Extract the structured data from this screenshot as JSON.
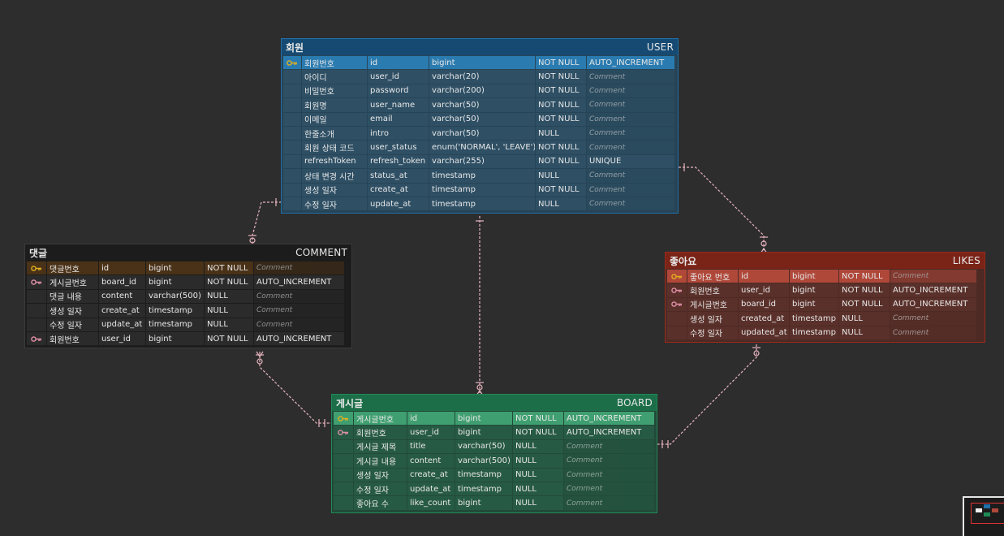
{
  "tables": [
    {
      "id": "user",
      "name": "회원",
      "english": "USER",
      "header_color": "#164a72",
      "body_color": "#274456",
      "cell_color": "#2e4f64",
      "pk_color": "#2a7bb0",
      "border_color": "#1f6fa8",
      "key_box_color": "#2e4f64",
      "columns": [
        {
          "key": "pk",
          "label": "회원번호",
          "name": "id",
          "type": "bigint",
          "null": "NOT NULL",
          "extra": "AUTO_INCREMENT",
          "is_comment": false
        },
        {
          "key": "",
          "label": "아이디",
          "name": "user_id",
          "type": "varchar(20)",
          "null": "NOT NULL",
          "extra": "Comment",
          "is_comment": true
        },
        {
          "key": "",
          "label": "비밀번호",
          "name": "password",
          "type": "varchar(200)",
          "null": "NOT NULL",
          "extra": "Comment",
          "is_comment": true
        },
        {
          "key": "",
          "label": "회원명",
          "name": "user_name",
          "type": "varchar(50)",
          "null": "NOT NULL",
          "extra": "Comment",
          "is_comment": true
        },
        {
          "key": "",
          "label": "이메일",
          "name": "email",
          "type": "varchar(50)",
          "null": "NOT NULL",
          "extra": "Comment",
          "is_comment": true
        },
        {
          "key": "",
          "label": "한줄소개",
          "name": "intro",
          "type": "varchar(50)",
          "null": "NULL",
          "extra": "Comment",
          "is_comment": true
        },
        {
          "key": "",
          "label": "회원 상태 코드",
          "name": "user_status",
          "type": "enum('NORMAL', 'LEAVE')",
          "null": "NOT NULL",
          "extra": "Comment",
          "is_comment": true
        },
        {
          "key": "",
          "label": "refreshToken",
          "name": "refresh_token",
          "type": "varchar(255)",
          "null": "NOT NULL",
          "extra": "UNIQUE",
          "is_comment": false
        },
        {
          "key": "",
          "label": "상태 변경 시간",
          "name": "status_at",
          "type": "timestamp",
          "null": "NULL",
          "extra": "Comment",
          "is_comment": true
        },
        {
          "key": "",
          "label": "생성 일자",
          "name": "create_at",
          "type": "timestamp",
          "null": "NOT NULL",
          "extra": "Comment",
          "is_comment": true
        },
        {
          "key": "",
          "label": "수정 일자",
          "name": "update_at",
          "type": "timestamp",
          "null": "NULL",
          "extra": "Comment",
          "is_comment": true
        }
      ]
    },
    {
      "id": "comment",
      "name": "댓글",
      "english": "COMMENT",
      "header_color": "#1c1c1c",
      "body_color": "#1c1c1c",
      "cell_color": "#2b2b2b",
      "pk_color": "#4a3218",
      "border_color": "#3a3a3a",
      "key_box_color": "#2b2b2b",
      "columns": [
        {
          "key": "pk",
          "label": "댓글번호",
          "name": "id",
          "type": "bigint",
          "null": "NOT NULL",
          "extra": "Comment",
          "is_comment": true
        },
        {
          "key": "fk",
          "label": "게시글번호",
          "name": "board_id",
          "type": "bigint",
          "null": "NOT NULL",
          "extra": "AUTO_INCREMENT",
          "is_comment": false
        },
        {
          "key": "",
          "label": "댓글 내용",
          "name": "content",
          "type": "varchar(500)",
          "null": "NULL",
          "extra": "Comment",
          "is_comment": true
        },
        {
          "key": "",
          "label": "생성 일자",
          "name": "create_at",
          "type": "timestamp",
          "null": "NULL",
          "extra": "Comment",
          "is_comment": true
        },
        {
          "key": "",
          "label": "수정 일자",
          "name": "update_at",
          "type": "timestamp",
          "null": "NULL",
          "extra": "Comment",
          "is_comment": true
        },
        {
          "key": "fk",
          "label": "회원번호",
          "name": "user_id",
          "type": "bigint",
          "null": "NOT NULL",
          "extra": "AUTO_INCREMENT",
          "is_comment": false
        }
      ]
    },
    {
      "id": "likes",
      "name": "좋아요",
      "english": "LIKES",
      "header_color": "#7a2418",
      "body_color": "#4e2a25",
      "cell_color": "#5a302a",
      "pk_color": "#b0483a",
      "border_color": "#9a2a1c",
      "key_box_color": "#5a302a",
      "columns": [
        {
          "key": "pk",
          "label": "좋아요 번호",
          "name": "id",
          "type": "bigint",
          "null": "NOT NULL",
          "extra": "Comment",
          "is_comment": true
        },
        {
          "key": "fk",
          "label": "회원번호",
          "name": "user_id",
          "type": "bigint",
          "null": "NOT NULL",
          "extra": "AUTO_INCREMENT",
          "is_comment": false
        },
        {
          "key": "fk",
          "label": "게시글번호",
          "name": "board_id",
          "type": "bigint",
          "null": "NOT NULL",
          "extra": "AUTO_INCREMENT",
          "is_comment": false
        },
        {
          "key": "",
          "label": "생성 일자",
          "name": "created_at",
          "type": "timestamp",
          "null": "NULL",
          "extra": "Comment",
          "is_comment": true
        },
        {
          "key": "",
          "label": "수정 일자",
          "name": "updated_at",
          "type": "timestamp",
          "null": "NULL",
          "extra": "Comment",
          "is_comment": true
        }
      ]
    },
    {
      "id": "board",
      "name": "게시글",
      "english": "BOARD",
      "header_color": "#1c6e48",
      "body_color": "#214a3a",
      "cell_color": "#275a44",
      "pk_color": "#3f9f70",
      "border_color": "#1f8a56",
      "key_box_color": "#275a44",
      "columns": [
        {
          "key": "pk",
          "label": "게시글번호",
          "name": "id",
          "type": "bigint",
          "null": "NOT NULL",
          "extra": "AUTO_INCREMENT",
          "is_comment": false
        },
        {
          "key": "fk",
          "label": "회원번호",
          "name": "user_id",
          "type": "bigint",
          "null": "NOT NULL",
          "extra": "AUTO_INCREMENT",
          "is_comment": false
        },
        {
          "key": "",
          "label": "게시글 제목",
          "name": "title",
          "type": "varchar(50)",
          "null": "NULL",
          "extra": "Comment",
          "is_comment": true
        },
        {
          "key": "",
          "label": "게시글 내용",
          "name": "content",
          "type": "varchar(500)",
          "null": "NULL",
          "extra": "Comment",
          "is_comment": true
        },
        {
          "key": "",
          "label": "생성 일자",
          "name": "create_at",
          "type": "timestamp",
          "null": "NULL",
          "extra": "Comment",
          "is_comment": true
        },
        {
          "key": "",
          "label": "수정 일자",
          "name": "update_at",
          "type": "timestamp",
          "null": "NULL",
          "extra": "Comment",
          "is_comment": true
        },
        {
          "key": "",
          "label": "좋아요 수",
          "name": "like_count",
          "type": "bigint",
          "null": "NULL",
          "extra": "Comment",
          "is_comment": true
        }
      ]
    }
  ],
  "colors": {
    "canvas": "#2d2d2d",
    "connector": "#e8b4c0",
    "pk_key": "#e0b020",
    "fk_key": "#e090a8"
  },
  "icons": {
    "primary_key": "key-icon",
    "foreign_key": "key-icon"
  }
}
